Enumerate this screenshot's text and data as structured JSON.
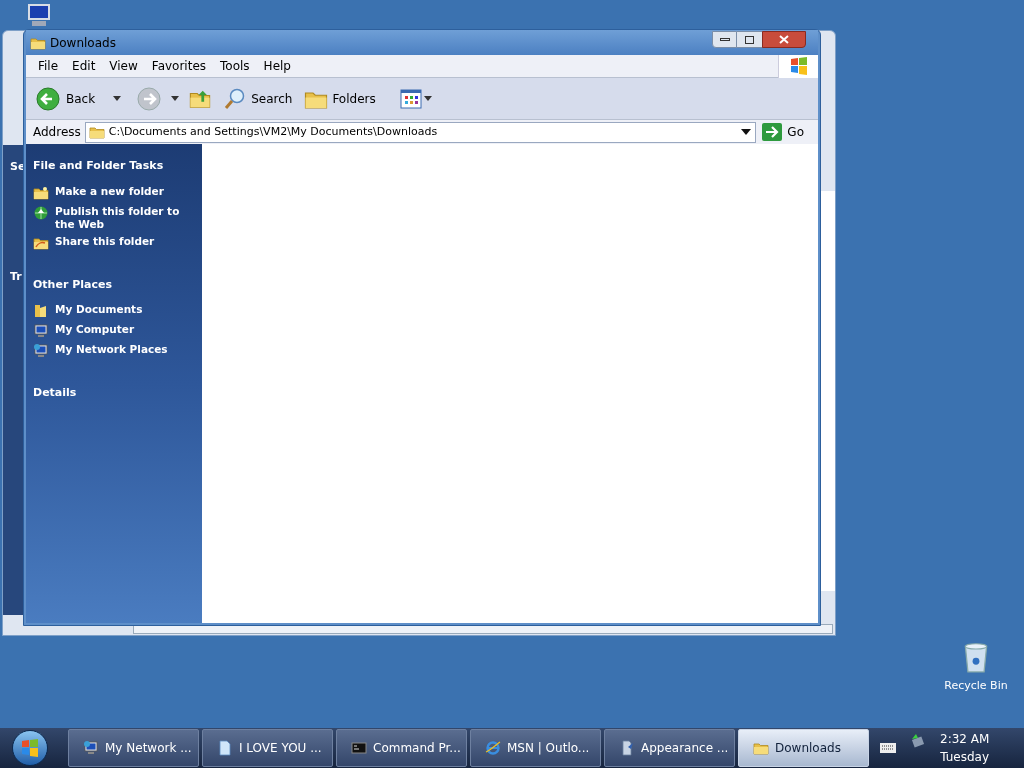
{
  "desktop": {
    "icons": [
      {
        "label": "Recycle Bin",
        "kind": "recycle"
      }
    ]
  },
  "background_window": {
    "fragments": [
      "Se",
      "Tr"
    ]
  },
  "window": {
    "title": "Downloads",
    "menu": [
      "File",
      "Edit",
      "View",
      "Favorites",
      "Tools",
      "Help"
    ],
    "toolbar": [
      {
        "kind": "back",
        "label": "Back"
      },
      {
        "kind": "forward"
      },
      {
        "kind": "up"
      },
      {
        "kind": "search",
        "label": "Search"
      },
      {
        "kind": "folders",
        "label": "Folders"
      },
      {
        "kind": "views"
      }
    ],
    "address": {
      "label": "Address",
      "value": "C:\\Documents and Settings\\VM2\\My Documents\\Downloads",
      "go": "Go"
    },
    "task_panes": [
      {
        "title": "File and Folder Tasks",
        "items": [
          {
            "kind": "new-folder",
            "label": "Make a new folder"
          },
          {
            "kind": "publish",
            "label": "Publish this folder to the Web"
          },
          {
            "kind": "share",
            "label": "Share this folder"
          }
        ]
      },
      {
        "title": "Other Places",
        "items": [
          {
            "kind": "documents",
            "label": "My Documents"
          },
          {
            "kind": "computer",
            "label": "My Computer"
          },
          {
            "kind": "network",
            "label": "My Network Places"
          }
        ]
      },
      {
        "title": "Details"
      }
    ]
  },
  "taskbar": {
    "buttons": [
      {
        "kind": "network",
        "label": "My Network ...",
        "selected": false
      },
      {
        "kind": "document",
        "label": "I LOVE YOU ...",
        "selected": false
      },
      {
        "kind": "console",
        "label": "Command Pr...",
        "selected": false
      },
      {
        "kind": "browser",
        "label": "MSN | Outlo...",
        "selected": false
      },
      {
        "kind": "appearance",
        "label": "Appearance ...",
        "selected": false
      },
      {
        "kind": "folder",
        "label": "Downloads",
        "selected": true
      }
    ],
    "clock": {
      "time": "2:32 AM",
      "day": "Tuesday"
    }
  }
}
